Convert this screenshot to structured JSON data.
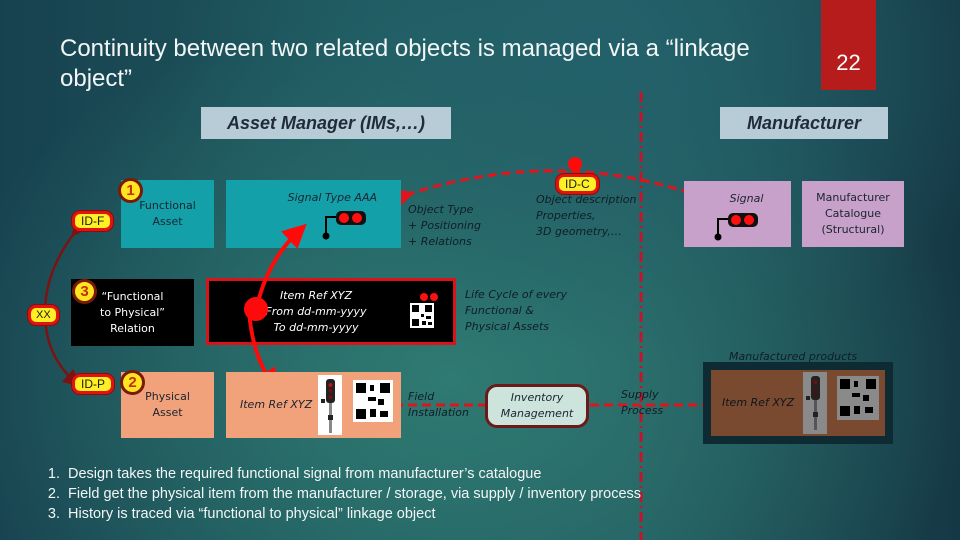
{
  "title": "Continuity between two related objects is managed via a “linkage object”",
  "slide_number": "22",
  "headers": {
    "asset_manager": "Asset Manager (IMs,…)",
    "manufacturer": "Manufacturer"
  },
  "ids": {
    "id_f": "ID-F",
    "xx": "XX",
    "id_p": "ID-P",
    "id_c": "ID-C"
  },
  "step_numbers": [
    "1",
    "2",
    "3"
  ],
  "boxes": {
    "functional_asset": [
      "Functional",
      "Asset"
    ],
    "signal_type": "Signal Type AAA",
    "f2p_relation": [
      "“Functional",
      "to Physical”",
      "Relation"
    ],
    "linkage_item": [
      "Item Ref XYZ",
      "From dd-mm-yyyy",
      "To dd-mm-yyyy"
    ],
    "physical_asset": [
      "Physical",
      "Asset"
    ],
    "physical_item": "Item Ref XYZ",
    "mfr_signal": "Signal",
    "mfr_catalogue": [
      "Manufacturer",
      "Catalogue",
      "(Structural)"
    ],
    "manufactured_item": "Item Ref XYZ",
    "inventory": [
      "Inventory",
      "Management"
    ]
  },
  "notes": {
    "object_type": [
      "Object Type",
      "+ Positioning",
      "+ Relations"
    ],
    "object_description": [
      "Object description",
      "Properties,",
      "3D geometry,…"
    ],
    "life_cycle": [
      "Life Cycle of every",
      "Functional  &",
      "Physical Assets"
    ],
    "field_installation": [
      "Field",
      "Installation"
    ],
    "supply_process": [
      "Supply",
      "Process"
    ],
    "manufactured_products": "Manufactured products"
  },
  "footer": [
    "Design takes the required functional signal from manufacturer’s catalogue",
    "Field get the physical item from the manufacturer / storage, via supply / inventory process",
    "History is traced via “functional to physical” linkage object"
  ],
  "colors": {
    "accent_red": "#b71c1c",
    "teal_box": "#13a0a8",
    "orange_box": "#f1a27a",
    "lilac_box": "#c7a1c9",
    "tag_yellow": "#ffef25"
  }
}
